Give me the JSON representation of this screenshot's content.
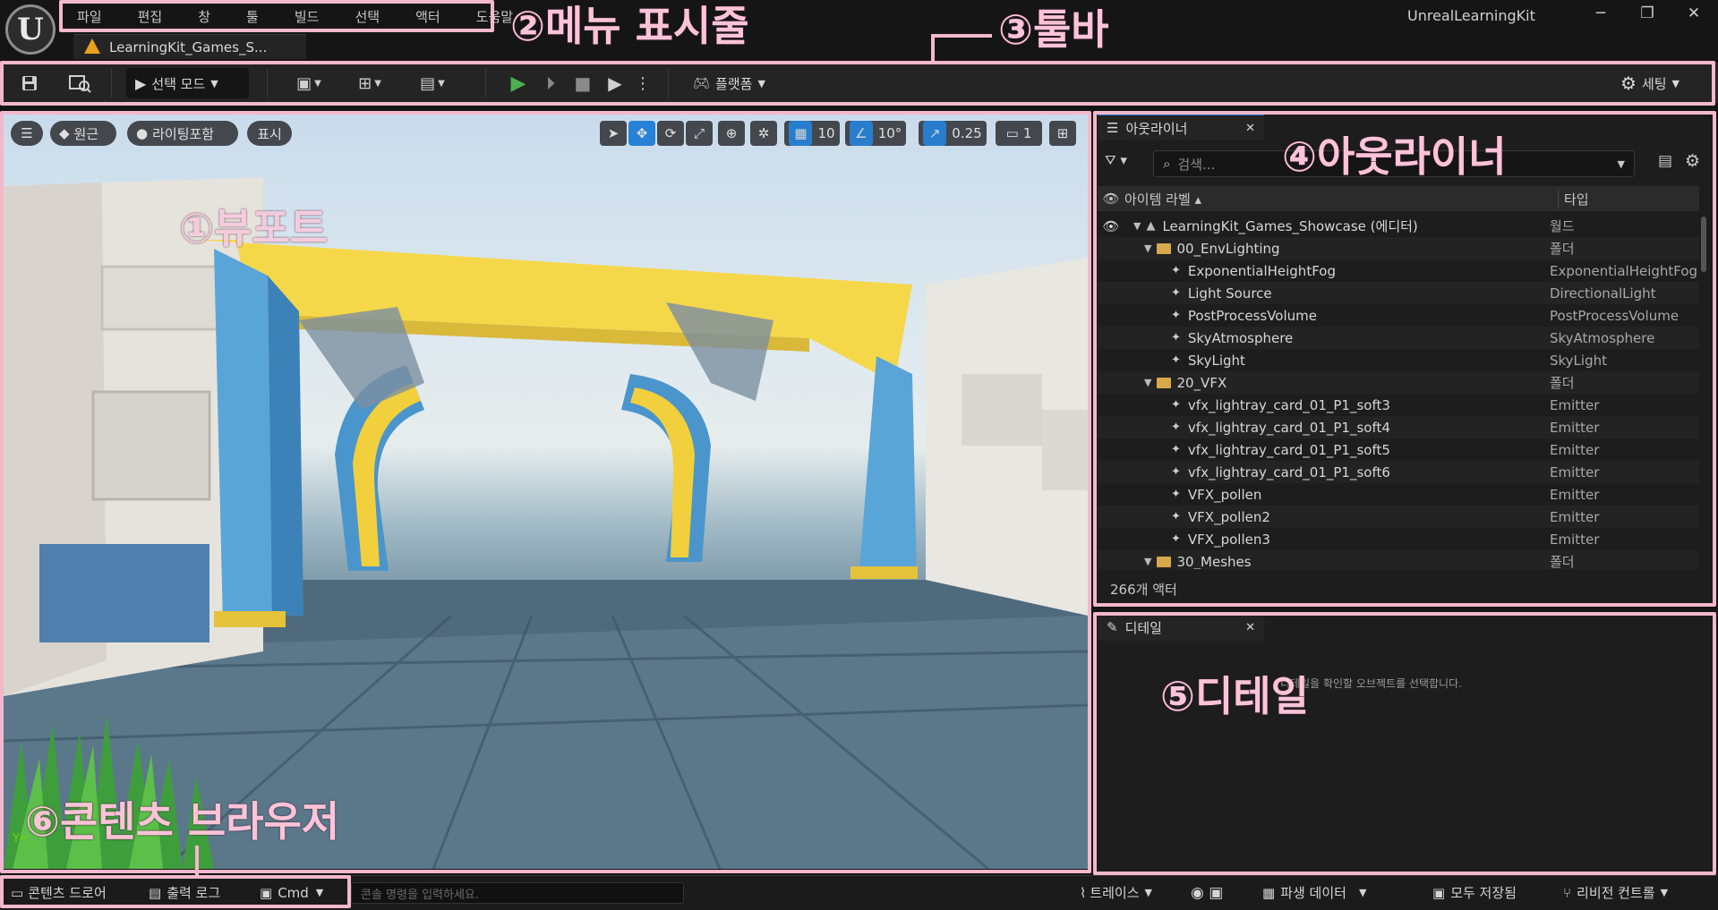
{
  "window": {
    "title": "UnrealLearningKit",
    "minimize": "─",
    "maximize": "❐",
    "close": "✕"
  },
  "logo": {
    "letter": "U"
  },
  "menu": [
    "파일",
    "편집",
    "창",
    "툴",
    "빌드",
    "선택",
    "액터",
    "도움말"
  ],
  "level_tab": {
    "label": "LearningKit_Games_S..."
  },
  "toolbar": {
    "select_mode": "선택 모드",
    "platform": "플랫폼",
    "settings": "세팅"
  },
  "viewport": {
    "perspective": "원근",
    "lighting": "라이팅포함",
    "show": "표시",
    "grid_snap": "10",
    "rotation_snap": "10°",
    "scale_snap": "0.25",
    "camera_speed": "1"
  },
  "outliner": {
    "tab_label": "아웃라이너",
    "search_placeholder": "검색...",
    "col_label": "아이템 라벨 ▴",
    "col_type": "타입",
    "rows": [
      {
        "label": "LearningKit_Games_Showcase (에디터)",
        "type": "월드",
        "indent": 0,
        "kind": "world"
      },
      {
        "label": "00_EnvLighting",
        "type": "폴더",
        "indent": 1,
        "kind": "folder"
      },
      {
        "label": "ExponentialHeightFog",
        "type": "ExponentialHeightFog",
        "indent": 2,
        "kind": "actor"
      },
      {
        "label": "Light Source",
        "type": "DirectionalLight",
        "indent": 2,
        "kind": "actor"
      },
      {
        "label": "PostProcessVolume",
        "type": "PostProcessVolume",
        "indent": 2,
        "kind": "actor"
      },
      {
        "label": "SkyAtmosphere",
        "type": "SkyAtmosphere",
        "indent": 2,
        "kind": "actor"
      },
      {
        "label": "SkyLight",
        "type": "SkyLight",
        "indent": 2,
        "kind": "actor"
      },
      {
        "label": "20_VFX",
        "type": "폴더",
        "indent": 1,
        "kind": "folder"
      },
      {
        "label": "vfx_lightray_card_01_P1_soft3",
        "type": "Emitter",
        "indent": 2,
        "kind": "actor"
      },
      {
        "label": "vfx_lightray_card_01_P1_soft4",
        "type": "Emitter",
        "indent": 2,
        "kind": "actor"
      },
      {
        "label": "vfx_lightray_card_01_P1_soft5",
        "type": "Emitter",
        "indent": 2,
        "kind": "actor"
      },
      {
        "label": "vfx_lightray_card_01_P1_soft6",
        "type": "Emitter",
        "indent": 2,
        "kind": "actor"
      },
      {
        "label": "VFX_pollen",
        "type": "Emitter",
        "indent": 2,
        "kind": "actor"
      },
      {
        "label": "VFX_pollen2",
        "type": "Emitter",
        "indent": 2,
        "kind": "actor"
      },
      {
        "label": "VFX_pollen3",
        "type": "Emitter",
        "indent": 2,
        "kind": "actor"
      },
      {
        "label": "30_Meshes",
        "type": "폴더",
        "indent": 1,
        "kind": "folder"
      }
    ],
    "actor_count": "266개 액터"
  },
  "details": {
    "tab_label": "디테일",
    "hint": "디테일을 확인할 오브젝트를 선택합니다."
  },
  "bottom": {
    "content_drawer": "콘텐츠 드로어",
    "output_log": "출력 로그",
    "cmd": "Cmd",
    "console_placeholder": "콘솔 명령을 입력하세요.",
    "trace": "트레이스",
    "derived_data": "파생 데이터",
    "save_all": "모두 저장됨",
    "revision_control": "리비전 컨트롤"
  },
  "annotations": {
    "viewport": "①뷰포트",
    "menubar": "②메뉴 표시줄",
    "toolbar": "③툴바",
    "outliner": "④아웃라이너",
    "details": "⑤디테일",
    "content_browser": "⑥콘텐츠 브라우저"
  },
  "colors": {
    "annotation": "#f4b8cc",
    "accent": "#1a7bd6",
    "play": "#4caf50",
    "warning": "#e8a020"
  }
}
